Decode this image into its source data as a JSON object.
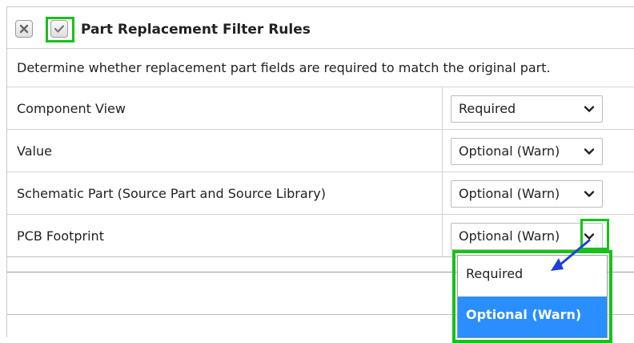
{
  "dialog": {
    "title": "Part Replacement Filter Rules",
    "description": "Determine whether replacement part fields are required to match the original part.",
    "close_icon": "close-icon",
    "confirm_icon": "checkmark-icon"
  },
  "rules": [
    {
      "label": "Component View",
      "value": "Required"
    },
    {
      "label": "Value",
      "value": "Optional (Warn)"
    },
    {
      "label": "Schematic Part (Source Part and Source Library)",
      "value": "Optional (Warn)"
    },
    {
      "label": "PCB Footprint",
      "value": "Optional (Warn)"
    }
  ],
  "dropdown": {
    "options": [
      {
        "label": "Required",
        "selected": false
      },
      {
        "label": "Optional (Warn)",
        "selected": true
      }
    ]
  },
  "colors": {
    "highlight": "#17c11b",
    "selected_option": "#2a8eff",
    "annotation_arrow": "#1f3fe0"
  }
}
